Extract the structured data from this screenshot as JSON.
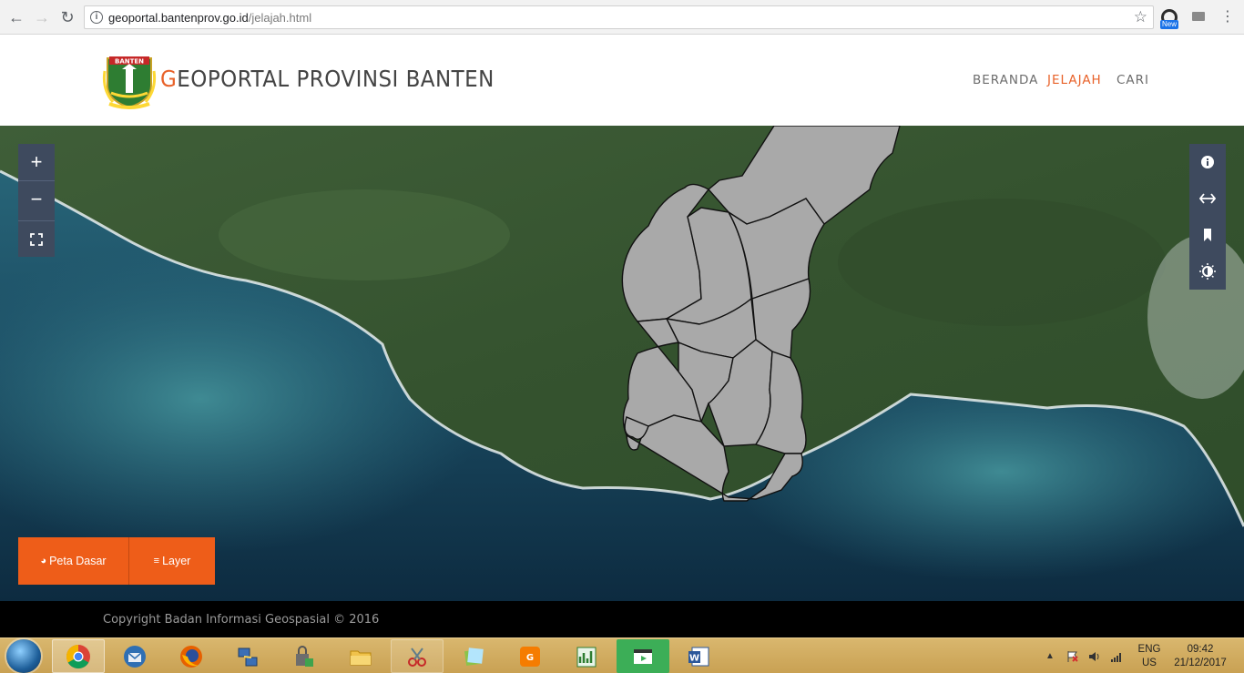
{
  "browser": {
    "url_host": "geoportal.bantenprov.go.id",
    "url_path": "/jelajah.html",
    "extension_badge": "New"
  },
  "header": {
    "logo_text": "BANTEN",
    "brand_first": "G",
    "brand_rest": "EOPORTAL PROVINSI BANTEN",
    "nav": [
      {
        "label": "BERANDA",
        "active": false
      },
      {
        "label": "JELAJAH",
        "active": true
      },
      {
        "label": "CARI",
        "active": false
      }
    ]
  },
  "map": {
    "zoom_in": "+",
    "zoom_out": "−",
    "basemap_button": "Peta Dasar",
    "layer_button": "Layer",
    "right_tools": [
      "info-icon",
      "swap-icon",
      "bookmark-icon",
      "contrast-icon"
    ],
    "colors": {
      "accent": "#ee5d19",
      "control": "#3e4a5e",
      "region_fill": "#a9a9a9"
    }
  },
  "footer": {
    "copyright": "Copyright Badan Informasi Geospasial © 2016"
  },
  "taskbar": {
    "apps": [
      "chrome",
      "thunderbird",
      "firefox",
      "network-tool",
      "security-tool",
      "file-explorer",
      "snipping-tool",
      "sticky-notes",
      "pdf-tool",
      "chart-tool",
      "media-tool",
      "word"
    ],
    "language": "ENG",
    "region": "US",
    "time": "09:42",
    "date": "21/12/2017"
  }
}
